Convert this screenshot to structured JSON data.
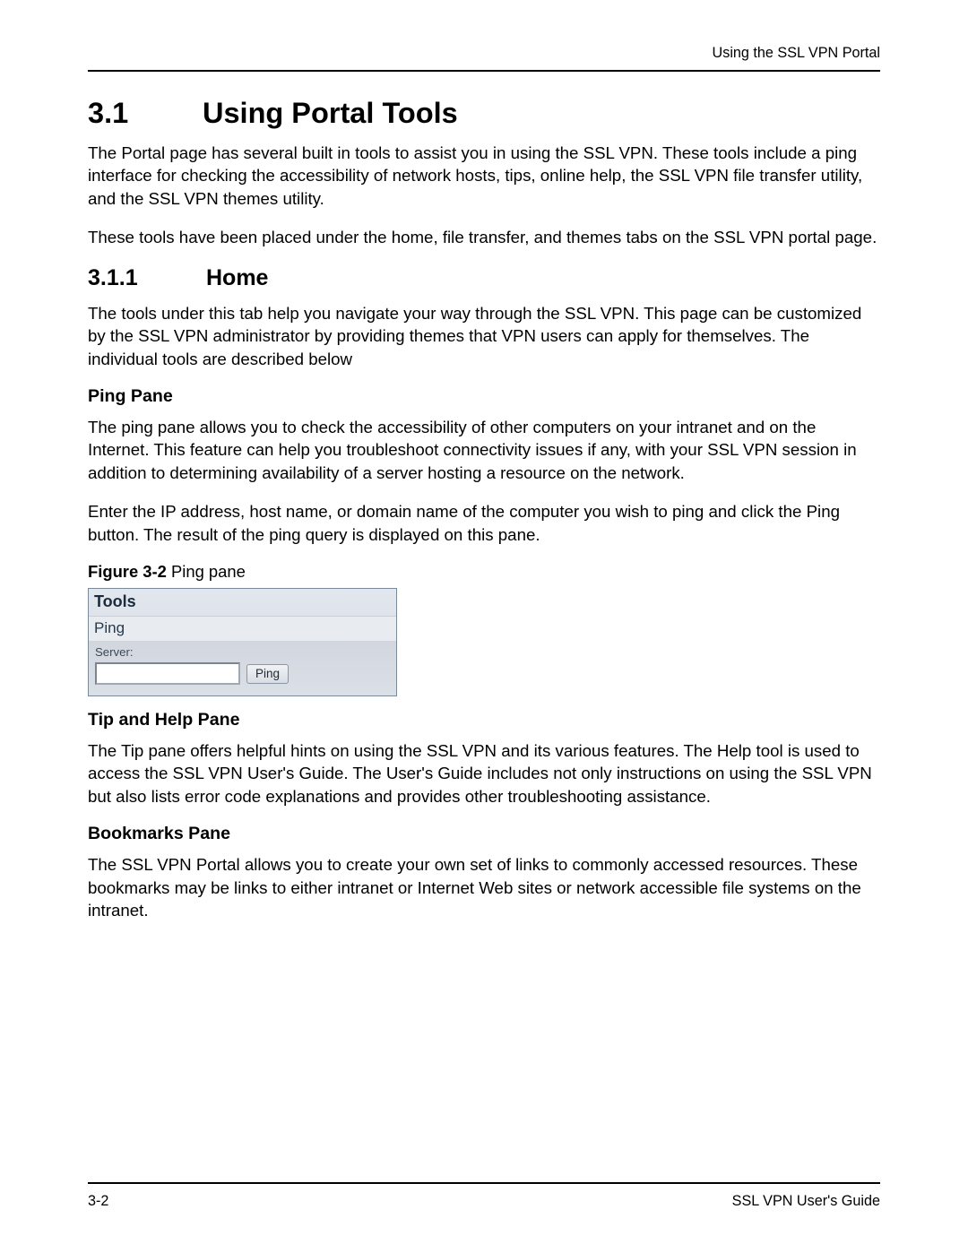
{
  "running_header": "Using the SSL VPN Portal",
  "h1": {
    "number": "3.1",
    "text": "Using Portal Tools"
  },
  "intro_p1": "The Portal page has several built in tools to assist you in using the SSL VPN. These tools include a ping interface for checking the accessibility of network hosts, tips, online help, the SSL VPN file transfer utility, and the SSL VPN themes utility.",
  "intro_p2": "These tools have been placed under the home, file transfer, and themes tabs on the SSL VPN portal page.",
  "h2": {
    "number": "3.1.1",
    "text": "Home"
  },
  "home_p1": "The tools under this tab help you navigate your way through the SSL VPN. This page can be customized by the SSL VPN administrator by providing themes that VPN users can apply for themselves. The individual tools are described below",
  "ping_h": "Ping Pane",
  "ping_p1": "The ping pane allows you to check the accessibility of other computers on your intranet and on the Internet. This feature can help you troubleshoot connectivity issues if any, with your SSL VPN session in addition to determining availability of a server hosting a resource on the network.",
  "ping_p2": "Enter the IP address, host name, or domain name of the computer you wish to ping and click the Ping button. The result of the ping query is displayed on this pane.",
  "figcap": {
    "bold": "Figure 3-2",
    "rest": "  Ping pane"
  },
  "figure": {
    "title": "Tools",
    "sub": "Ping",
    "label": "Server:",
    "input_value": "",
    "button": "Ping"
  },
  "tip_h": "Tip and Help Pane",
  "tip_p": "The Tip pane offers helpful hints on using the SSL VPN and its various features. The Help tool is used to access the SSL VPN User's Guide. The User's Guide includes not only instructions on using the SSL VPN but also lists error code explanations and provides other troubleshooting assistance.",
  "bm_h": "Bookmarks Pane",
  "bm_p": "The SSL VPN Portal allows you to create your own set of links to commonly accessed resources. These bookmarks may be links to either intranet or Internet Web sites or network accessible file systems on the intranet.",
  "footer": {
    "left": "3-2",
    "right": "SSL VPN User's Guide"
  }
}
